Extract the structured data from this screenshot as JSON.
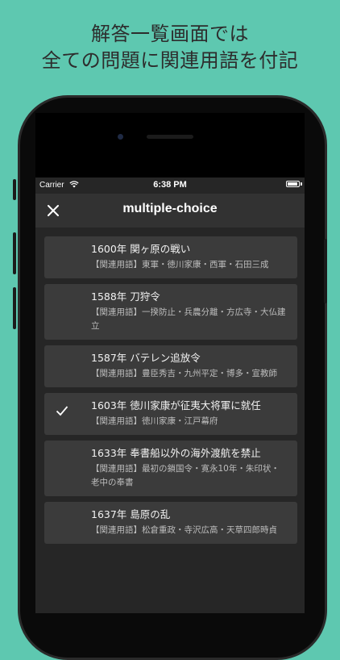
{
  "promo": {
    "line1": "解答一覧画面では",
    "line2": "全ての問題に関連用語を付記"
  },
  "status": {
    "carrier": "Carrier",
    "time": "6:38 PM"
  },
  "nav": {
    "title": "multiple-choice",
    "close_icon": "close-icon"
  },
  "items": [
    {
      "title": "1600年 関ヶ原の戦い",
      "related": "【関連用語】東軍・徳川家康・西軍・石田三成",
      "checked": false
    },
    {
      "title": "1588年 刀狩令",
      "related": "【関連用語】一揆防止・兵農分離・方広寺・大仏建立",
      "checked": false
    },
    {
      "title": "1587年 バテレン追放令",
      "related": "【関連用語】豊臣秀吉・九州平定・博多・宣教師",
      "checked": false
    },
    {
      "title": "1603年 徳川家康が征夷大将軍に就任",
      "related": "【関連用語】徳川家康・江戸幕府",
      "checked": true
    },
    {
      "title": "1633年 奉書船以外の海外渡航を禁止",
      "related": "【関連用語】最初の鎖国令・寛永10年・朱印状・老中の奉書",
      "checked": false
    },
    {
      "title": "1637年 島原の乱",
      "related": "【関連用語】松倉重政・寺沢広高・天草四郎時貞",
      "checked": false
    }
  ],
  "colors": {
    "background": "#5ec8b0",
    "card": "#3b3b3b",
    "navbar": "#323232"
  }
}
